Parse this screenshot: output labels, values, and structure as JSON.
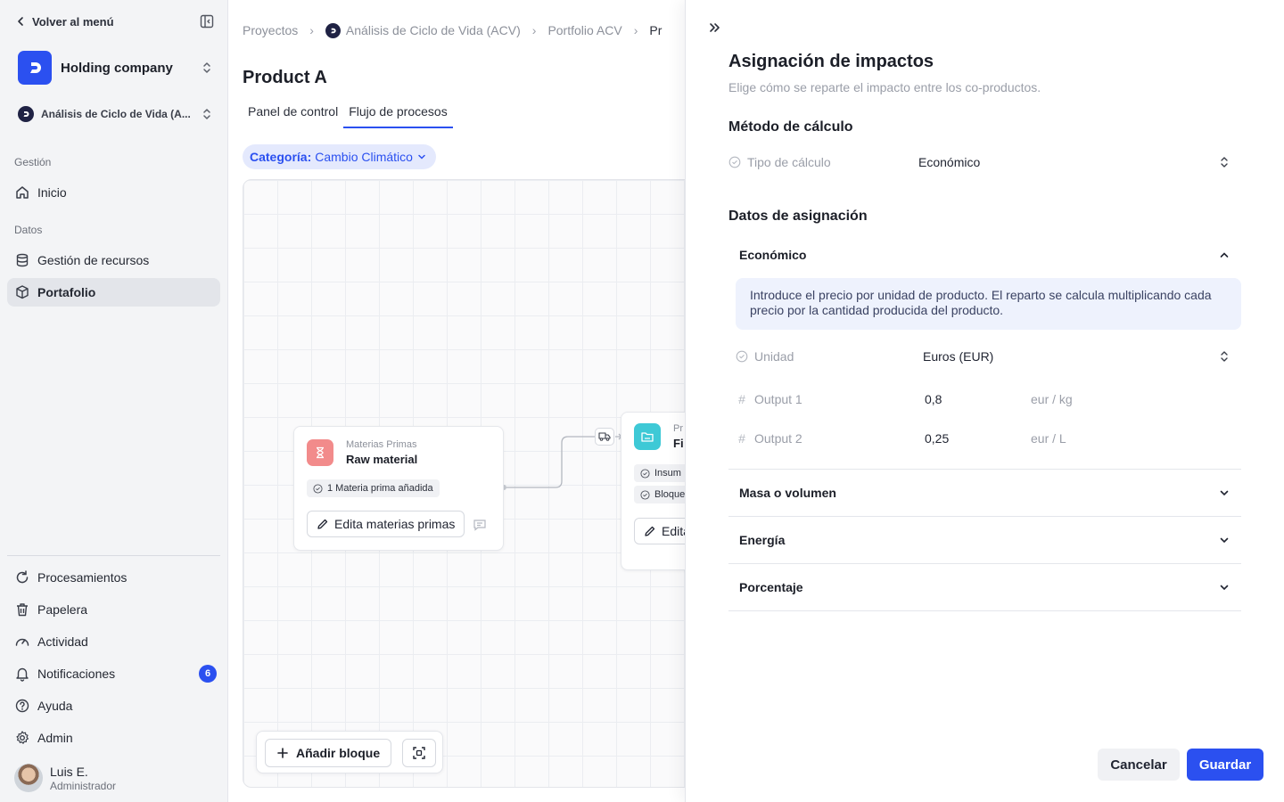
{
  "sidebar": {
    "back_label": "Volver al menú",
    "org_name": "Holding company",
    "project_name": "Análisis de Ciclo de Vida (A...",
    "sections": {
      "management": "Gestión",
      "data": "Datos"
    },
    "items": {
      "home": "Inicio",
      "resources": "Gestión de recursos",
      "portfolio": "Portafolio",
      "processing": "Procesamientos",
      "trash": "Papelera",
      "activity": "Actividad",
      "notifications": "Notificaciones",
      "help": "Ayuda",
      "admin": "Admin"
    },
    "notifications_count": "6",
    "user": {
      "name": "Luis E.",
      "role": "Administrador"
    }
  },
  "main": {
    "breadcrumbs": [
      "Proyectos",
      "Análisis de Ciclo de Vida (ACV)",
      "Portfolio ACV",
      "Pr"
    ],
    "title": "Product A",
    "tabs": [
      "Panel de control",
      "Flujo de procesos"
    ],
    "active_tab": 1,
    "category": {
      "label": "Categoría:",
      "value": "Cambio Climático"
    },
    "nodes": {
      "raw": {
        "kind": "Materias Primas",
        "name": "Raw material",
        "chip": "1 Materia prima añadida",
        "button": "Edita materias primas"
      },
      "second": {
        "kind": "Pr",
        "name": "Fi",
        "chip1": "Insum",
        "chip2": "Bloque",
        "button": "Edita"
      }
    },
    "toolbar": {
      "add_block": "Añadir bloque"
    }
  },
  "panel": {
    "title": "Asignación de impactos",
    "subtitle": "Elige cómo se reparte el impacto entre los co-productos.",
    "method_heading": "Método de cálculo",
    "calc_type": {
      "label": "Tipo de cálculo",
      "value": "Económico"
    },
    "allocation_heading": "Datos de asignación",
    "sections": {
      "economic": {
        "title": "Económico",
        "info": "Introduce el precio por unidad de producto. El reparto se calcula multiplicando cada precio por la cantidad producida del producto.",
        "unit": {
          "label": "Unidad",
          "value": "Euros (EUR)"
        },
        "outputs": [
          {
            "label": "Output 1",
            "value": "0,8",
            "unit": "eur / kg"
          },
          {
            "label": "Output 2",
            "value": "0,25",
            "unit": "eur / L"
          }
        ]
      },
      "mass": {
        "title": "Masa o volumen"
      },
      "energy": {
        "title": "Energía"
      },
      "percentage": {
        "title": "Porcentaje"
      }
    },
    "buttons": {
      "cancel": "Cancelar",
      "save": "Guardar"
    }
  },
  "colors": {
    "accent": "#2b50f0",
    "raw_node": "#f28b8b",
    "process_node": "#3ec9d6"
  }
}
